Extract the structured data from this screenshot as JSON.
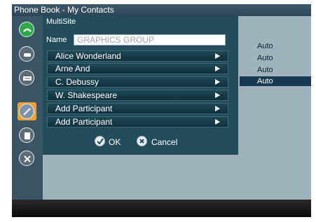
{
  "window": {
    "title": "Phone Book - My Contacts"
  },
  "dialog": {
    "title": "MultiSite",
    "name_label": "Name",
    "name_value": "GRAPHICS GROUP",
    "participants": [
      {
        "label": "Alice Wonderland"
      },
      {
        "label": "Arne And"
      },
      {
        "label": "C. Debussy"
      },
      {
        "label": "W. Shakespeare"
      },
      {
        "label": "Add Participant"
      },
      {
        "label": "Add Participant"
      }
    ],
    "ok_label": "OK",
    "cancel_label": "Cancel"
  },
  "right_list": [
    "Auto",
    "Auto",
    "Auto",
    "Auto"
  ],
  "sidebar": {
    "icons": [
      "phone-call-icon",
      "contacts-icon",
      "phonebook-icon",
      "multisite-icon",
      "document-icon",
      "tools-icon"
    ]
  },
  "colors": {
    "accent": "#f0a030",
    "dialog_bg": "#234d5c",
    "selected": "#173a54"
  }
}
